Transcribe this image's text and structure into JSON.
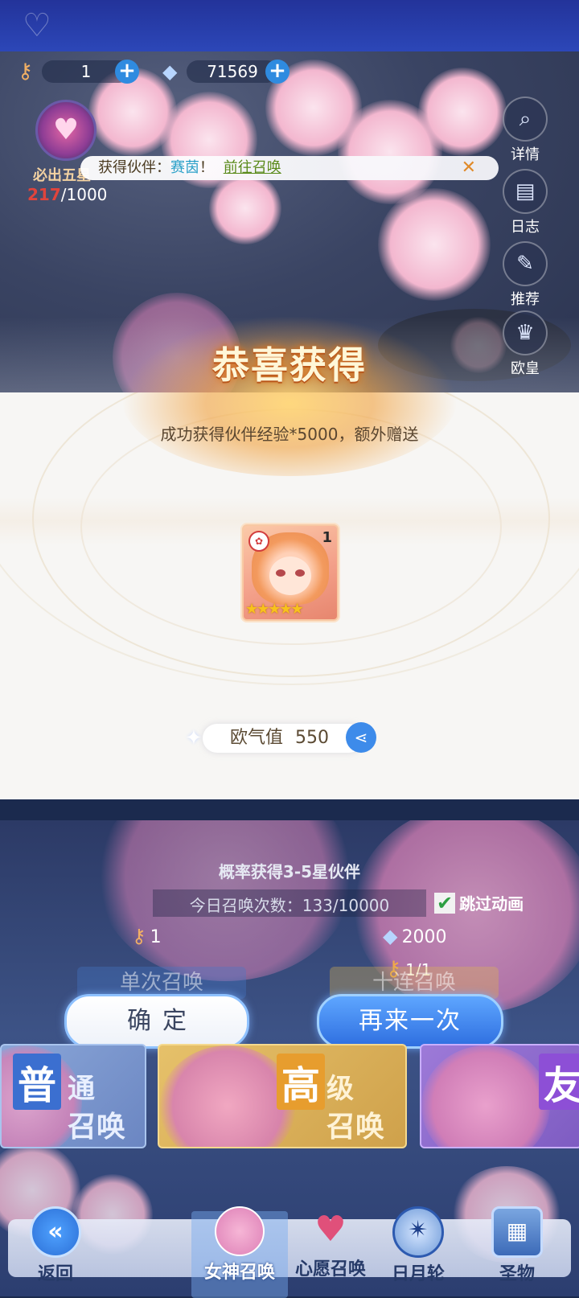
{
  "header": {
    "currency1_value": "1",
    "currency2_value": "71569"
  },
  "pity": {
    "label": "必出五星",
    "current": "217",
    "total": "/1000"
  },
  "side_menu": [
    {
      "label": "详情",
      "icon": "magnifier-icon"
    },
    {
      "label": "日志",
      "icon": "book-icon"
    },
    {
      "label": "推荐",
      "icon": "quill-icon"
    },
    {
      "label": "欧皇",
      "icon": "crown-icon"
    }
  ],
  "notification": {
    "prefix": "获得伙伴：",
    "name": "赛茵",
    "suffix": "！",
    "link": "前往召唤",
    "close": "✕"
  },
  "reward": {
    "title": "恭喜获得",
    "subtitle": "成功获得伙伴经验*5000，额外赠送",
    "item_count": "1",
    "stars": "★★★★★",
    "luck_label": "欧气值",
    "luck_value": "550"
  },
  "summon": {
    "probability_text": "概率获得3-5星伙伴",
    "daily_count": "今日召唤次数：133/10000",
    "skip_anim": "跳过动画",
    "single_cost": "1",
    "ten_cost": "2000",
    "ten_ticket": "1/1",
    "single_label": "单次召唤",
    "ten_label": "十连召唤"
  },
  "buttons": {
    "confirm": "确定",
    "again": "再来一次"
  },
  "summon_types": [
    {
      "big": "普",
      "small1": "通",
      "small2": "召唤"
    },
    {
      "big": "高",
      "small1": "级",
      "small2": "召唤"
    },
    {
      "big": "友"
    }
  ],
  "nav": [
    {
      "label": "返回"
    },
    {
      "label": "女神召唤"
    },
    {
      "label": "心愿召唤"
    },
    {
      "label": "日月轮"
    },
    {
      "label": "圣物"
    }
  ],
  "colors": {
    "accent_blue": "#2f6fe0",
    "gold": "#f8c21c",
    "pity_red": "#e0443c"
  }
}
